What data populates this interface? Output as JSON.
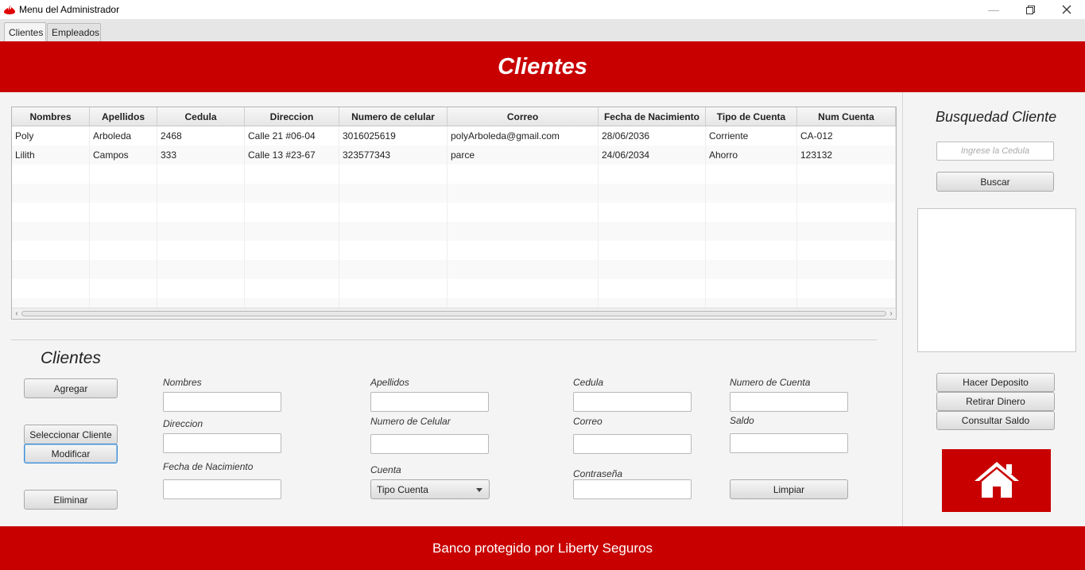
{
  "colors": {
    "brand_red": "#c80000",
    "white": "#ffffff"
  },
  "window": {
    "title": "Menu del Administrador",
    "app_icon": "santander-flame-icon",
    "controls": [
      "minimize-icon",
      "restore-icon",
      "close-icon"
    ]
  },
  "tabs": [
    {
      "label": "Clientes",
      "active": true
    },
    {
      "label": "Empleados",
      "active": false
    }
  ],
  "header": {
    "title": "Clientes"
  },
  "table": {
    "columns": [
      "Nombres",
      "Apellidos",
      "Cedula",
      "Direccion",
      "Numero de celular",
      "Correo",
      "Fecha de Nacimiento",
      "Tipo de Cuenta",
      "Num Cuenta"
    ],
    "rows": [
      [
        "Poly",
        "Arboleda",
        "2468",
        "Calle 21 #06-04",
        "3016025619",
        "polyArboleda@gmail.com",
        "28/06/2036",
        "Corriente",
        "CA-012"
      ],
      [
        "Lilith",
        "Campos",
        "333",
        "Calle 13 #23-67",
        "323577343",
        "parce",
        "24/06/2034",
        "Ahorro",
        "123132"
      ]
    ]
  },
  "form": {
    "title": "Clientes",
    "buttons": {
      "agregar": "Agregar",
      "seleccionar": "Seleccionar Cliente",
      "modificar": "Modificar",
      "eliminar": "Eliminar",
      "limpiar": "Limpiar"
    },
    "labels": {
      "nombres": "Nombres",
      "direccion": "Direccion",
      "fecha_nacimiento": "Fecha de Nacimiento",
      "apellidos": "Apellidos",
      "numero_celular": "Numero de Celular",
      "cuenta": "Cuenta",
      "cedula": "Cedula",
      "correo": "Correo",
      "contrasena": "Contraseña",
      "numero_cuenta": "Numero de Cuenta",
      "saldo": "Saldo"
    },
    "values": {
      "nombres": "",
      "direccion": "",
      "fecha_nacimiento": "",
      "apellidos": "",
      "numero_celular": "",
      "cedula": "",
      "correo": "",
      "contrasena": "",
      "numero_cuenta": "",
      "saldo": ""
    },
    "cuenta_select": {
      "selected": "Tipo Cuenta"
    }
  },
  "search": {
    "title": "Busquedad Cliente",
    "placeholder": "Ingrese la Cedula",
    "button": "Buscar",
    "actions": {
      "deposito": "Hacer Deposito",
      "retirar": "Retirar Dinero",
      "consultar": "Consultar Saldo"
    },
    "home_icon": "home-icon"
  },
  "footer": {
    "text": "Banco protegido por Liberty Seguros"
  }
}
